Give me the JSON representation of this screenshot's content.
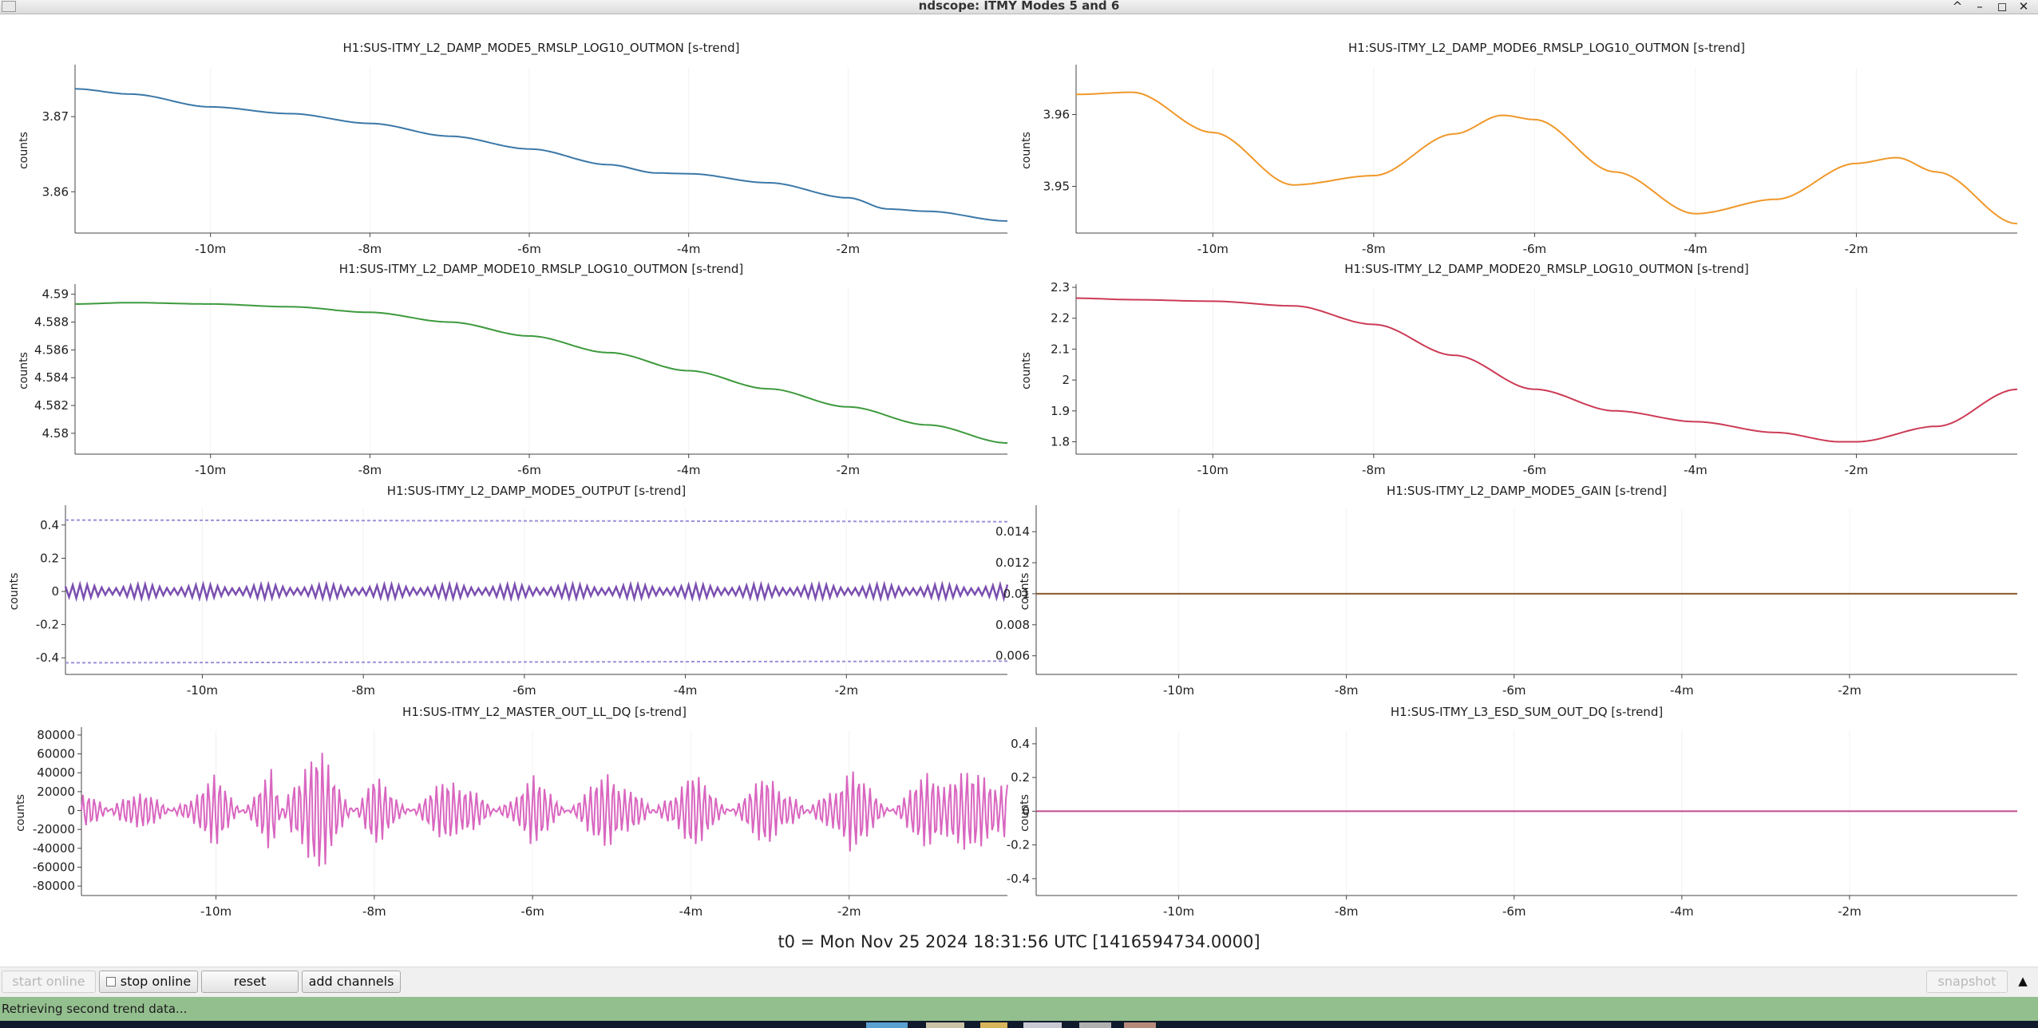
{
  "window": {
    "title": "ndscope: ITMY Modes 5 and 6",
    "controls": [
      "^",
      "–",
      "◻",
      "✕"
    ]
  },
  "plots": [
    {
      "title": "H1:SUS-ITMY_L2_DAMP_MODE5_RMSLP_LOG10_OUTMON [s-trend]",
      "ylabel": "counts",
      "color": "#3b78a8",
      "yticks": [
        "3.87",
        "3.86"
      ],
      "xticks": [
        "-10m",
        "-8m",
        "-6m",
        "-4m",
        "-2m"
      ],
      "chart_data": {
        "type": "line",
        "x_unit": "minutes",
        "ylim": [
          3.8545,
          3.8765
        ],
        "x": [
          -11.7,
          -11,
          -10,
          -9,
          -8,
          -7,
          -6,
          -5,
          -4.4,
          -4,
          -3,
          -2,
          -1.5,
          -1,
          0
        ],
        "values": [
          3.8737,
          3.873,
          3.8713,
          3.8704,
          3.8691,
          3.8674,
          3.8657,
          3.8636,
          3.8625,
          3.8624,
          3.8612,
          3.8592,
          3.8577,
          3.8574,
          3.8561
        ]
      }
    },
    {
      "title": "H1:SUS-ITMY_L2_DAMP_MODE6_RMSLP_LOG10_OUTMON [s-trend]",
      "ylabel": "counts",
      "color": "#f0982a",
      "yticks": [
        "3.96",
        "3.95"
      ],
      "xticks": [
        "-10m",
        "-8m",
        "-6m",
        "-4m",
        "-2m"
      ],
      "chart_data": {
        "type": "line",
        "x_unit": "minutes",
        "ylim": [
          3.9435,
          3.9665
        ],
        "x": [
          -11.7,
          -11,
          -10,
          -9,
          -8,
          -7,
          -6.4,
          -6,
          -5,
          -4,
          -3,
          -2,
          -1.5,
          -1,
          0
        ],
        "values": [
          3.9628,
          3.9631,
          3.9575,
          3.9502,
          3.9515,
          3.9573,
          3.9599,
          3.9593,
          3.952,
          3.9462,
          3.9482,
          3.9532,
          3.954,
          3.952,
          3.9448
        ]
      }
    },
    {
      "title": "H1:SUS-ITMY_L2_DAMP_MODE10_RMSLP_LOG10_OUTMON [s-trend]",
      "ylabel": "counts",
      "color": "#3d9a3d",
      "yticks": [
        "4.59",
        "4.588",
        "4.586",
        "4.584",
        "4.582",
        "4.58"
      ],
      "xticks": [
        "-10m",
        "-8m",
        "-6m",
        "-4m",
        "-2m"
      ],
      "chart_data": {
        "type": "line",
        "x_unit": "minutes",
        "ylim": [
          4.5785,
          4.5905
        ],
        "x": [
          -11.7,
          -11,
          -10,
          -9,
          -8,
          -7,
          -6,
          -5,
          -4,
          -3,
          -2,
          -1,
          0
        ],
        "values": [
          4.5893,
          4.5894,
          4.5893,
          4.5891,
          4.5887,
          4.588,
          4.587,
          4.5858,
          4.5845,
          4.5832,
          4.5819,
          4.5806,
          4.5793
        ]
      }
    },
    {
      "title": "H1:SUS-ITMY_L2_DAMP_MODE20_RMSLP_LOG10_OUTMON [s-trend]",
      "ylabel": "counts",
      "color": "#cc3b55",
      "yticks": [
        "2.3",
        "2.2",
        "2.1",
        "2",
        "1.9",
        "1.8"
      ],
      "xticks": [
        "-10m",
        "-8m",
        "-6m",
        "-4m",
        "-2m"
      ],
      "chart_data": {
        "type": "line",
        "x_unit": "minutes",
        "ylim": [
          1.76,
          2.3
        ],
        "x": [
          -11.7,
          -11,
          -10,
          -9,
          -8,
          -7,
          -6,
          -5,
          -4,
          -3,
          -2.2,
          -2,
          -1,
          0
        ],
        "values": [
          2.265,
          2.26,
          2.255,
          2.24,
          2.18,
          2.08,
          1.97,
          1.9,
          1.865,
          1.83,
          1.8,
          1.8,
          1.85,
          1.97
        ]
      }
    },
    {
      "title": "H1:SUS-ITMY_L2_DAMP_MODE5_OUTPUT [s-trend]",
      "ylabel": "counts",
      "color": "#7b4fb0",
      "yticks": [
        "0.4",
        "0.2",
        "0",
        "-0.2",
        "-0.4"
      ],
      "xticks": [
        "-10m",
        "-8m",
        "-6m",
        "-4m",
        "-2m"
      ],
      "chart_data": {
        "type": "line",
        "x_unit": "minutes",
        "ylim": [
          -0.5,
          0.5
        ],
        "x": [
          -11.7,
          0
        ],
        "series": [
          {
            "values": [
              0.03,
              0.03
            ]
          },
          {
            "values": [
              -0.03,
              -0.03
            ]
          },
          {
            "values": [
              0.43,
              0.42
            ]
          },
          {
            "values": [
              -0.43,
              -0.42
            ]
          }
        ]
      }
    },
    {
      "title": "H1:SUS-ITMY_L2_DAMP_MODE5_GAIN [s-trend]",
      "ylabel": "counts",
      "color": "#8a5a2b",
      "yticks": [
        "0.014",
        "0.012",
        "0.01",
        "0.008",
        "0.006"
      ],
      "xticks": [
        "-10m",
        "-8m",
        "-6m",
        "-4m",
        "-2m"
      ],
      "chart_data": {
        "type": "line",
        "x_unit": "minutes",
        "ylim": [
          0.0048,
          0.0155
        ],
        "x": [
          -11.7,
          0
        ],
        "values": [
          0.01,
          0.01
        ]
      }
    },
    {
      "title": "H1:SUS-ITMY_L2_MASTER_OUT_LL_DQ [s-trend]",
      "ylabel": "counts",
      "color": "#d966c0",
      "yticks": [
        "80000",
        "60000",
        "40000",
        "20000",
        "0",
        "-20000",
        "-40000",
        "-60000",
        "-80000"
      ],
      "xticks": [
        "-10m",
        "-8m",
        "-6m",
        "-4m",
        "-2m"
      ],
      "chart_data": {
        "type": "line",
        "x_unit": "minutes",
        "ylim": [
          -90000,
          85000
        ],
        "x": [
          -11.7,
          -11,
          -10,
          -9.3,
          -9,
          -8.7,
          -8,
          -7,
          -6,
          -5,
          -4,
          -3,
          -2,
          -1,
          0
        ],
        "values": [
          30000,
          -30000,
          40000,
          -45000,
          50000,
          70000,
          -40000,
          45000,
          -40000,
          50000,
          -45000,
          45000,
          -50000,
          45000,
          40000
        ]
      }
    },
    {
      "title": "H1:SUS-ITMY_L3_ESD_SUM_OUT_DQ [s-trend]",
      "ylabel": "counts",
      "color": "#c04a8e",
      "yticks": [
        "0.4",
        "0.2",
        "0",
        "-0.2",
        "-0.4"
      ],
      "xticks": [
        "-10m",
        "-8m",
        "-6m",
        "-4m",
        "-2m"
      ],
      "chart_data": {
        "type": "line",
        "x_unit": "minutes",
        "ylim": [
          -0.5,
          0.48
        ],
        "x": [
          -11.7,
          0
        ],
        "values": [
          0,
          0
        ]
      }
    }
  ],
  "t0": "t0 = Mon Nov 25 2024 18:31:56 UTC [1416594734.0000]",
  "toolbar": {
    "start_online": "start online",
    "stop_online": "stop online",
    "reset": "reset",
    "add_channels": "add channels",
    "snapshot": "snapshot",
    "expand": "▲"
  },
  "status": "Retrieving second trend data..."
}
